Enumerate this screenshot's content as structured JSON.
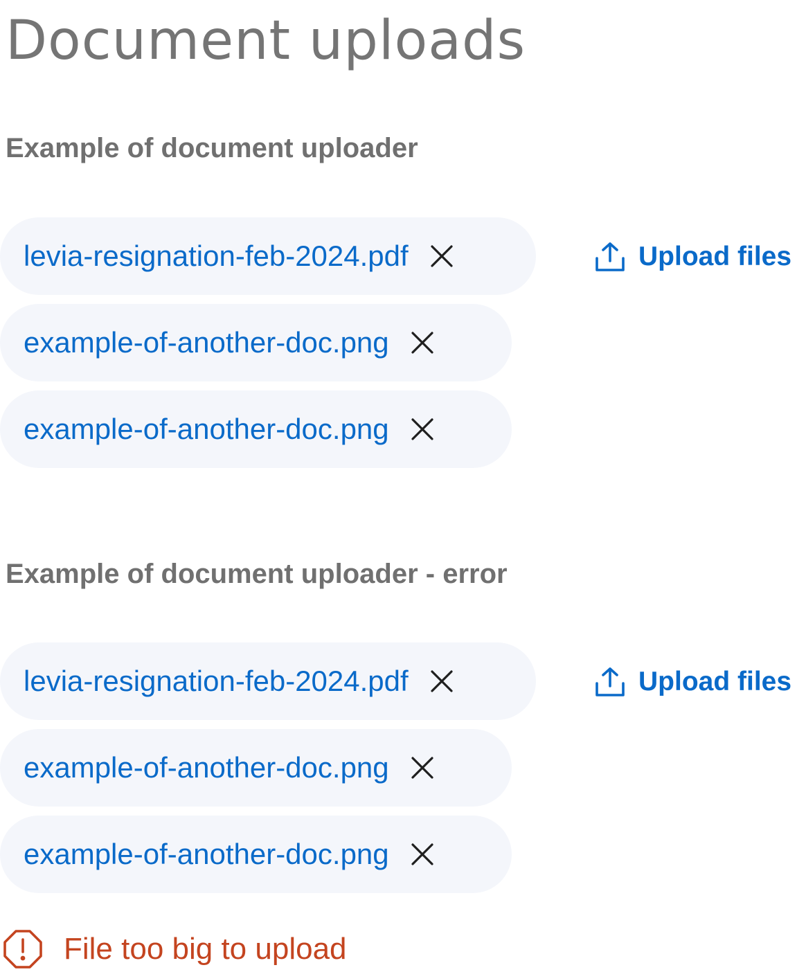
{
  "page": {
    "title": "Document uploads"
  },
  "sections": [
    {
      "heading": "Example of document uploader",
      "files": [
        "levia-resignation-feb-2024.pdf",
        "example-of-another-doc.png",
        "example-of-another-doc.png"
      ],
      "upload_label": "Upload files"
    },
    {
      "heading": "Example of document uploader - error",
      "files": [
        "levia-resignation-feb-2024.pdf",
        "example-of-another-doc.png",
        "example-of-another-doc.png"
      ],
      "upload_label": "Upload files",
      "error": {
        "message": "File too big to upload",
        "icon": "alert-octagon-icon"
      }
    }
  ],
  "icons": {
    "remove": "close-icon",
    "upload": "upload-icon"
  },
  "colors": {
    "title": "#757575",
    "heading": "#707070",
    "link": "#0a6ac9",
    "chip_background": "#f4f6fb",
    "error": "#c4441f",
    "close_icon": "#1f1f1f"
  }
}
